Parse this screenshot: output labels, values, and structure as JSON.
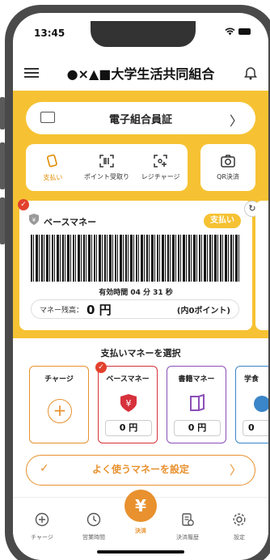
{
  "status_bar": {
    "time": "13:45"
  },
  "header": {
    "title": "●×▲■大学生活共同組合",
    "menu_icon": "menu-icon",
    "bell_icon": "bell-icon"
  },
  "member_card": {
    "label": "電子組合員証"
  },
  "actions": [
    {
      "label": "支払い",
      "icon": "wallet-icon",
      "active": true
    },
    {
      "label": "ポイント受取り",
      "icon": "barcode-scan-icon",
      "active": false
    },
    {
      "label": "レジチャージ",
      "icon": "charge-icon",
      "active": false
    }
  ],
  "qr": {
    "label": "QR決済",
    "icon": "camera-icon"
  },
  "payment_card": {
    "money_name": "ベースマネー",
    "pay_pill": "支払い",
    "valid_time": "有効時間 04 分 31 秒",
    "balance_label": "マネー残高：",
    "balance_value": "0 円",
    "points": "(内0ポイント)"
  },
  "select_title": "支払いマネーを選択",
  "money_cards": [
    {
      "title": "チャージ",
      "value": "",
      "color": "#E8912E"
    },
    {
      "title": "ベースマネー",
      "value": "0 円",
      "color": "#D6313B"
    },
    {
      "title": "書籍マネー",
      "value": "0 円",
      "color": "#8B4FB8"
    },
    {
      "title": "学食",
      "value": "0",
      "color": "#3A86C8"
    }
  ],
  "favorite_button": {
    "label": "よく使うマネーを設定"
  },
  "tabs": [
    {
      "label": "チャージ",
      "icon": "plus-circle-icon"
    },
    {
      "label": "営業時間",
      "icon": "clock-icon"
    },
    {
      "label": "決済",
      "icon": "yen-icon"
    },
    {
      "label": "決済履歴",
      "icon": "receipt-icon"
    },
    {
      "label": "設定",
      "icon": "gear-icon"
    }
  ],
  "colors": {
    "accent_yellow": "#F6C233",
    "accent_orange": "#E8912E",
    "red": "#E2412D"
  }
}
